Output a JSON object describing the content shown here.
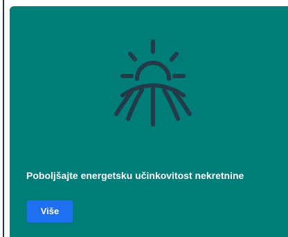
{
  "card": {
    "background_color": "#007d79",
    "icon": "sunrise-icon",
    "title": "Poboljšajte energetsku učinkovitost nekretnine",
    "button_label": "Više",
    "button_color": "#1f6ff2"
  }
}
